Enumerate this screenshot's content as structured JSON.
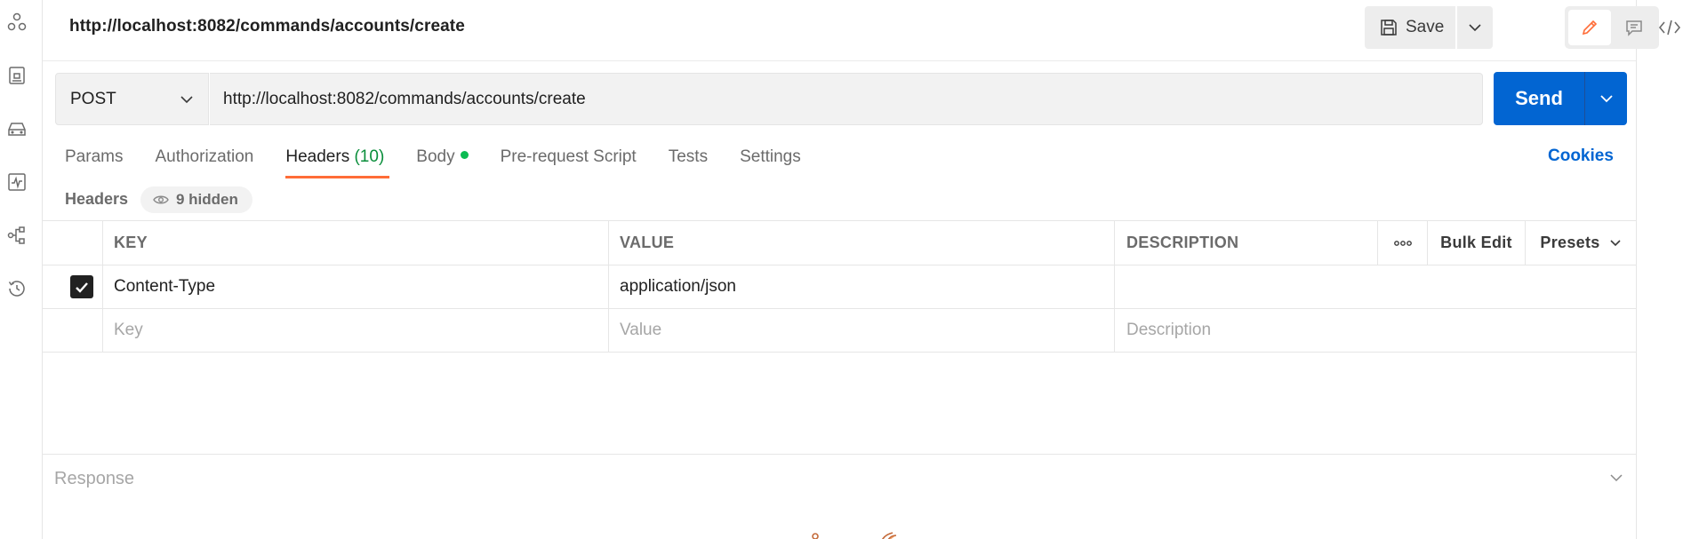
{
  "titlebar": {
    "url": "http://localhost:8082/commands/accounts/create",
    "save_label": "Save"
  },
  "request": {
    "method": "POST",
    "url": "http://localhost:8082/commands/accounts/create",
    "send_label": "Send"
  },
  "tabs": [
    {
      "label": "Params"
    },
    {
      "label": "Authorization"
    },
    {
      "label": "Headers",
      "count": "(10)",
      "active": true
    },
    {
      "label": "Body",
      "has_content_dot": true
    },
    {
      "label": "Pre-request Script"
    },
    {
      "label": "Tests"
    },
    {
      "label": "Settings"
    }
  ],
  "cookies_label": "Cookies",
  "headers_section": {
    "label": "Headers",
    "hidden_label": "9 hidden"
  },
  "table": {
    "columns": {
      "key": "KEY",
      "value": "VALUE",
      "description": "DESCRIPTION",
      "bulk_edit": "Bulk Edit",
      "presets": "Presets"
    },
    "rows": [
      {
        "checked": true,
        "key": "Content-Type",
        "value": "application/json",
        "description": ""
      }
    ],
    "placeholders": {
      "key": "Key",
      "value": "Value",
      "description": "Description"
    }
  },
  "response": {
    "title": "Response"
  },
  "colors": {
    "accent": "#ff6c37",
    "primary": "#0265d2",
    "success": "#0cbb52"
  },
  "icons": {
    "left_sidebar": [
      "collections-icon",
      "apis-icon",
      "environments-icon",
      "monitors-icon",
      "flows-icon",
      "history-icon"
    ],
    "right_sidebar": [
      "code-icon"
    ]
  }
}
